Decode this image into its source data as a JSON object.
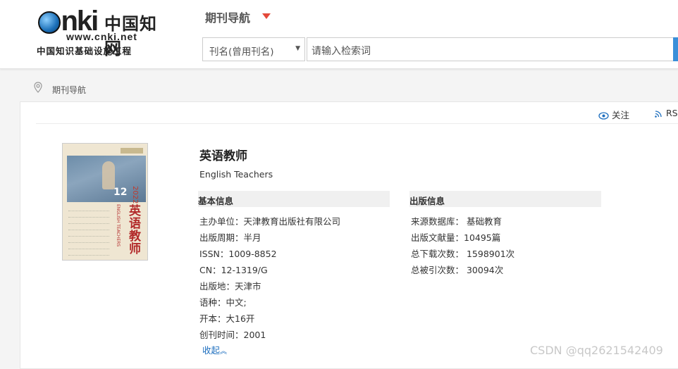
{
  "header": {
    "logo_text": "CNKi中国知网",
    "logo_url": "www.cnki.net",
    "logo_subtitle": "中国知识基础设施工程",
    "nav_title": "期刊导航",
    "search_field_select": "刊名(曾用刊名)",
    "search_placeholder": "请输入检索词"
  },
  "breadcrumb": {
    "text": "期刊导航"
  },
  "actions": {
    "follow": "关注",
    "rss": "RSS"
  },
  "journal": {
    "cover_issue": "12",
    "cover_year": "2022",
    "cover_title": "英语教师",
    "cover_en": "ENGLISH TEACHERS",
    "title": "英语教师",
    "english_title": "English Teachers",
    "basic_header": "基本信息",
    "basic": [
      "主办单位：天津教育出版社有限公司",
      "出版周期：半月",
      "ISSN：1009-8852",
      "CN：12-1319/G",
      "出版地：天津市",
      "语种：中文;",
      "开本：大16开",
      "创刊时间：2001"
    ],
    "pub_header": "出版信息",
    "pub": [
      "来源数据库：  基础教育",
      "出版文献量：10495篇",
      "总下载次数：  1598901次",
      "总被引次数：  30094次"
    ],
    "collapse": "收起"
  },
  "watermark": "CSDN @qq2621542409",
  "colors": {
    "accent_blue": "#3a8fd9",
    "caret_red": "#e4493a",
    "link_blue": "#1e6fbf"
  }
}
